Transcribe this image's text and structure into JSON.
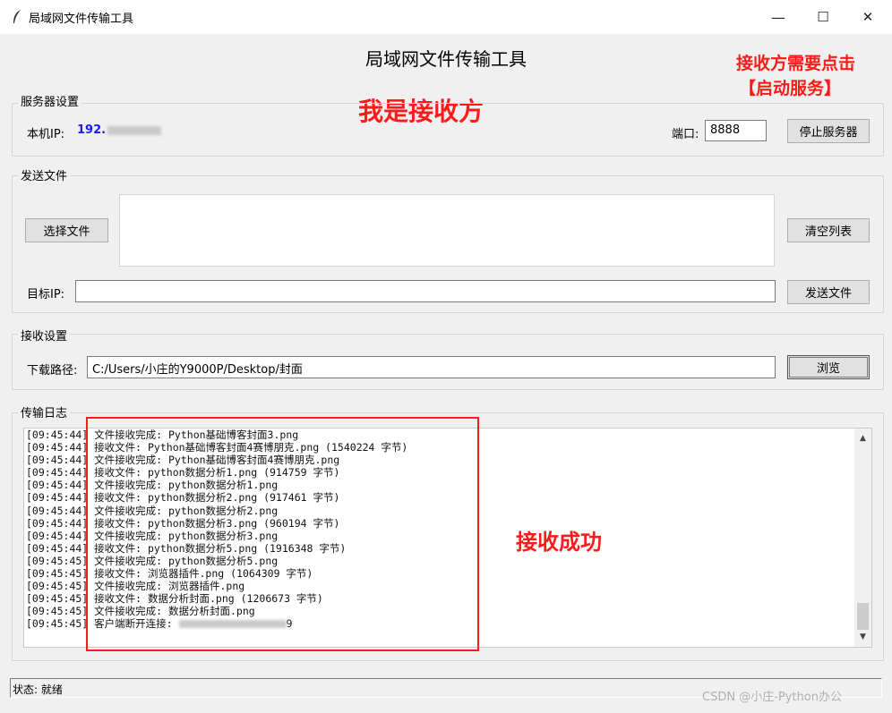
{
  "window": {
    "title": "局域网文件传输工具",
    "minimize": "—",
    "maximize": "☐",
    "close": "✕"
  },
  "app": {
    "heading": "局域网文件传输工具"
  },
  "annotations": {
    "receiver_hint_line1": "接收方需要点击",
    "receiver_hint_line2": "【启动服务】",
    "i_am_receiver": "我是接收方",
    "receive_success": "接收成功"
  },
  "server": {
    "group_label": "服务器设置",
    "local_ip_label": "本机IP:",
    "local_ip_value": "192.",
    "port_label": "端口:",
    "port_value": "8888",
    "stop_button": "停止服务器"
  },
  "send": {
    "group_label": "发送文件",
    "choose_button": "选择文件",
    "clear_button": "清空列表",
    "target_ip_label": "目标IP:",
    "target_ip_value": "",
    "send_button": "发送文件"
  },
  "receive": {
    "group_label": "接收设置",
    "download_path_label": "下载路径:",
    "download_path_value": "C:/Users/小庄的Y9000P/Desktop/封面",
    "browse_button": "浏览"
  },
  "log": {
    "group_label": "传输日志",
    "lines": [
      "[09:45:44] 文件接收完成: Python基础博客封面3.png",
      "[09:45:44] 接收文件: Python基础博客封面4赛博朋克.png (1540224 字节)",
      "[09:45:44] 文件接收完成: Python基础博客封面4赛博朋克.png",
      "[09:45:44] 接收文件: python数据分析1.png (914759 字节)",
      "[09:45:44] 文件接收完成: python数据分析1.png",
      "[09:45:44] 接收文件: python数据分析2.png (917461 字节)",
      "[09:45:44] 文件接收完成: python数据分析2.png",
      "[09:45:44] 接收文件: python数据分析3.png (960194 字节)",
      "[09:45:44] 文件接收完成: python数据分析3.png",
      "[09:45:44] 接收文件: python数据分析5.png (1916348 字节)",
      "[09:45:45] 文件接收完成: python数据分析5.png",
      "[09:45:45] 接收文件: 浏览器插件.png (1064309 字节)",
      "[09:45:45] 文件接收完成: 浏览器插件.png",
      "[09:45:45] 接收文件: 数据分析封面.png (1206673 字节)",
      "[09:45:45] 文件接收完成: 数据分析封面.png"
    ],
    "last_line_prefix": "[09:45:45] 客户端断开连接: ",
    "last_line_suffix": "9"
  },
  "status": {
    "text": "状态: 就绪"
  },
  "watermark": "CSDN @小庄-Python办公",
  "icons": {
    "app": "feather-icon",
    "scroll_up": "▲",
    "scroll_down": "▼"
  }
}
